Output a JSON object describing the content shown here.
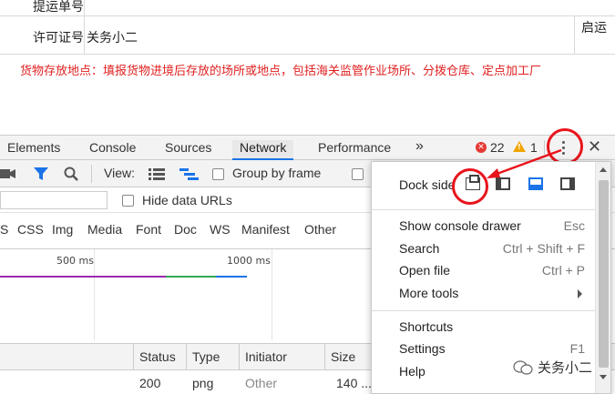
{
  "page": {
    "label_bill": "提运单号",
    "label_license": "许可证号",
    "license_value": "关务小二",
    "side_label": "启运",
    "notice": "货物存放地点：填报货物进境后存放的场所或地点，包括海关监管作业场所、分拨仓库、定点加工厂"
  },
  "devtools": {
    "tabs": [
      "Elements",
      "Console",
      "Sources",
      "Network",
      "Performance"
    ],
    "more_tabs": "»",
    "error_count": "22",
    "warning_count": "1",
    "toolbar": {
      "view_label": "View:",
      "group_by_frame": "Group by frame"
    },
    "filter": {
      "hide_data_urls": "Hide data URLs"
    },
    "types": [
      "S",
      "CSS",
      "Img",
      "Media",
      "Font",
      "Doc",
      "WS",
      "Manifest",
      "Other"
    ],
    "timeline": {
      "label_500": "500 ms",
      "label_1000": "1000 ms"
    },
    "table": {
      "headers": [
        "Status",
        "Type",
        "Initiator",
        "Size"
      ],
      "row": {
        "status": "200",
        "type": "png",
        "initiator": "Other",
        "size": "140 ..."
      }
    }
  },
  "menu": {
    "dock_side": "Dock side",
    "items": [
      {
        "label": "Show console drawer",
        "shortcut": "Esc"
      },
      {
        "label": "Search",
        "shortcut": "Ctrl + Shift + F"
      },
      {
        "label": "Open file",
        "shortcut": "Ctrl + P"
      },
      {
        "label": "More tools",
        "shortcut": ""
      }
    ],
    "items2": [
      {
        "label": "Shortcuts",
        "shortcut": ""
      },
      {
        "label": "Settings",
        "shortcut": "F1"
      },
      {
        "label": "Help",
        "shortcut": ""
      }
    ]
  },
  "watermark": "关务小二",
  "colors": {
    "accent_blue": "#1a73e8",
    "annotation_red": "#e8141c",
    "error_red": "#e53935",
    "warning_orange": "#f0a500",
    "notice_red": "#e02020"
  }
}
